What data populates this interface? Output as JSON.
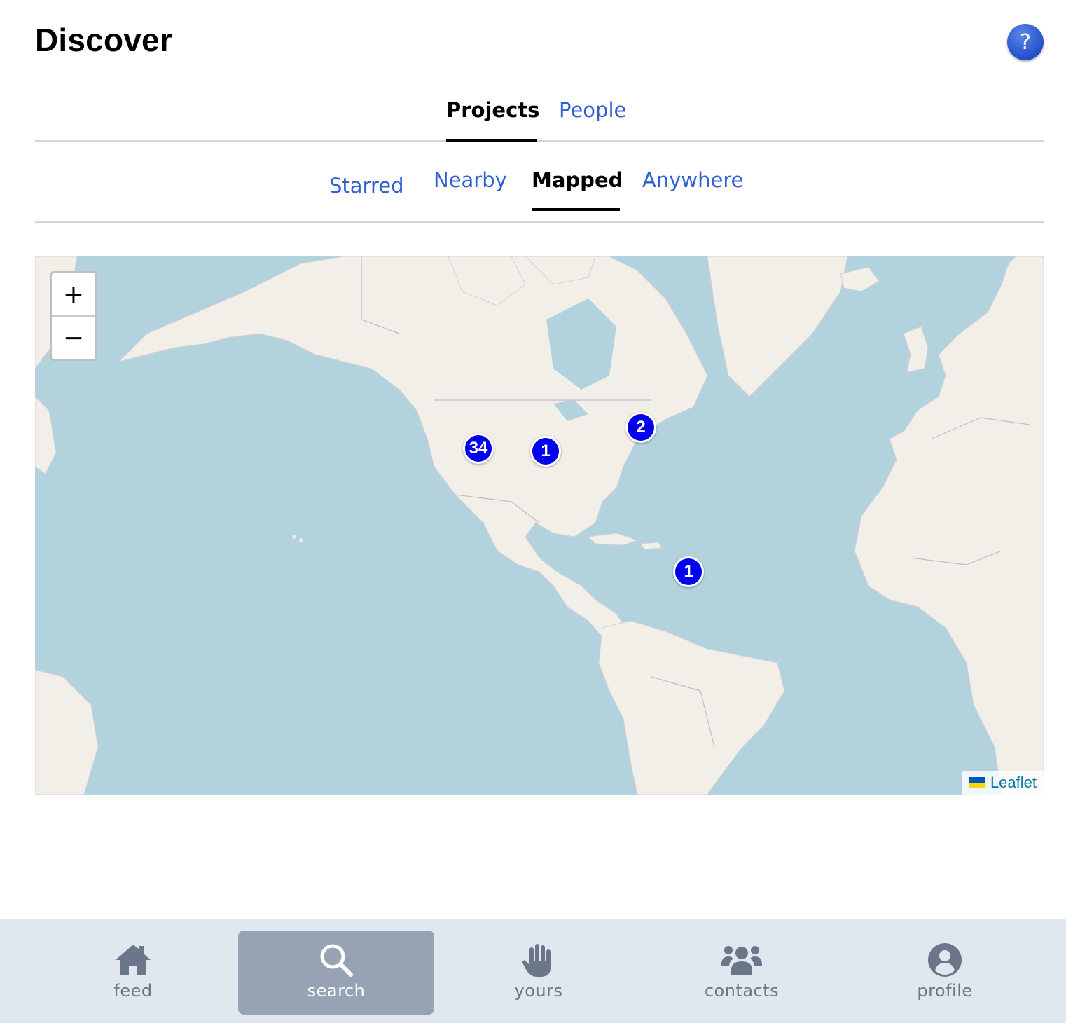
{
  "header": {
    "title": "Discover",
    "help_label": "?"
  },
  "primary_tabs": [
    {
      "label": "Projects",
      "active": true
    },
    {
      "label": "People",
      "active": false
    }
  ],
  "secondary_tabs": [
    {
      "label": "Starred",
      "active": false
    },
    {
      "label": "Nearby",
      "active": false
    },
    {
      "label": "Mapped",
      "active": true
    },
    {
      "label": "Anywhere",
      "active": false
    }
  ],
  "map": {
    "zoom_in_label": "+",
    "zoom_out_label": "−",
    "clusters": [
      {
        "count": "34",
        "region": "western-us"
      },
      {
        "count": "1",
        "region": "central-us"
      },
      {
        "count": "2",
        "region": "northeast-us"
      },
      {
        "count": "1",
        "region": "caribbean"
      }
    ],
    "attribution": "Leaflet",
    "colors": {
      "water": "#b2d3de",
      "land": "#f2efe9",
      "border": "#c9b8c8",
      "cluster": "#0000ee"
    }
  },
  "bottom_nav": {
    "items": [
      {
        "label": "feed",
        "icon": "home-icon",
        "active": false
      },
      {
        "label": "search",
        "icon": "search-icon",
        "active": true
      },
      {
        "label": "yours",
        "icon": "hand-icon",
        "active": false
      },
      {
        "label": "contacts",
        "icon": "users-icon",
        "active": false
      },
      {
        "label": "profile",
        "icon": "user-circle-icon",
        "active": false
      }
    ]
  },
  "colors": {
    "link": "#2f5fd6",
    "nav_background": "#e1e7ef",
    "nav_active": "#97a3b5",
    "nav_text": "#6b7689"
  }
}
